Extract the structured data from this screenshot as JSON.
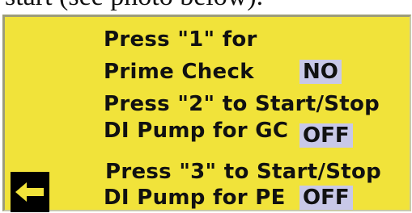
{
  "caption": {
    "text": "start (see photo below)."
  },
  "screen": {
    "background_color": "#f1e33a",
    "status_box_color": "#c8c8e8",
    "prime_check": {
      "line1": "Press \"1\" for",
      "line2": "Prime Check",
      "value": "NO"
    },
    "gc_pump": {
      "line1": "Press \"2\" to Start/Stop",
      "line2": "DI Pump for GC",
      "value": "OFF"
    },
    "pe_pump": {
      "line1": "Press \"3\" to Start/Stop",
      "line2": "DI Pump for PE",
      "value": "OFF"
    },
    "back_button": {
      "icon": "arrow-left-icon"
    }
  }
}
